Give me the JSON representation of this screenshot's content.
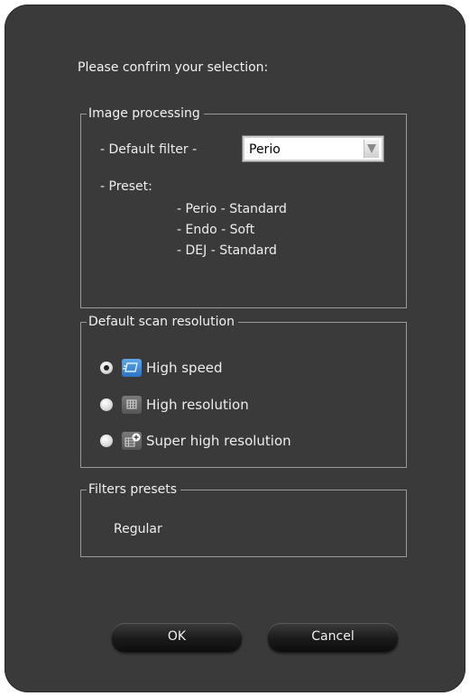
{
  "dialog": {
    "prompt": "Please confrim your selection:",
    "image_processing": {
      "legend": "Image processing",
      "default_filter_label": "-  Default filter  -",
      "default_filter_value": "Perio",
      "preset_label": "-  Preset:",
      "presets": [
        "-  Perio - Standard",
        "-  Endo - Soft",
        "-  DEJ - Standard"
      ]
    },
    "scan_resolution": {
      "legend": "Default scan resolution",
      "options": [
        {
          "label": "High speed",
          "selected": true
        },
        {
          "label": "High resolution",
          "selected": false
        },
        {
          "label": "Super high resolution",
          "selected": false
        }
      ]
    },
    "filters_presets": {
      "legend": "Filters presets",
      "value": "Regular"
    },
    "buttons": {
      "ok": "OK",
      "cancel": "Cancel"
    },
    "icons": {
      "dropdown": "chevron-down-icon",
      "high_speed": "high-speed-scan-icon",
      "high_resolution": "high-resolution-scan-icon",
      "super_high_resolution": "super-high-resolution-scan-icon"
    },
    "colors": {
      "background": "#3a3a3a",
      "text": "#eeeeee",
      "border": "#9a9a9a",
      "active_icon": "#3d8ad6"
    }
  }
}
